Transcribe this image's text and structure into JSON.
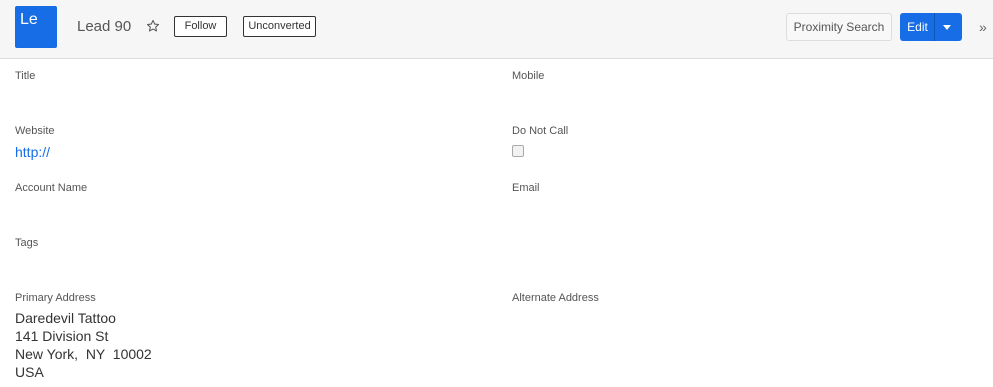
{
  "header": {
    "avatar_text": "Le",
    "record_name": "Lead 90",
    "follow_label": "Follow",
    "status_label": "Unconverted",
    "proximity_label": "Proximity Search",
    "edit_label": "Edit",
    "more_glyph": "»",
    "star_icon": "star-outline-icon",
    "caret_icon": "caret-down-icon",
    "accent_color": "#176de5"
  },
  "fields": {
    "title": {
      "label": "Title",
      "value": ""
    },
    "mobile": {
      "label": "Mobile",
      "value": ""
    },
    "website": {
      "label": "Website",
      "value": "http://"
    },
    "do_not_call": {
      "label": "Do Not Call",
      "checked": false
    },
    "account_name": {
      "label": "Account Name",
      "value": ""
    },
    "email": {
      "label": "Email",
      "value": ""
    },
    "tags": {
      "label": "Tags",
      "value": ""
    },
    "primary_address": {
      "label": "Primary Address",
      "lines": [
        "Daredevil Tattoo",
        "141 Division St",
        "New York,  NY  10002",
        "USA"
      ]
    },
    "alternate_address": {
      "label": "Alternate Address",
      "value": ""
    }
  }
}
